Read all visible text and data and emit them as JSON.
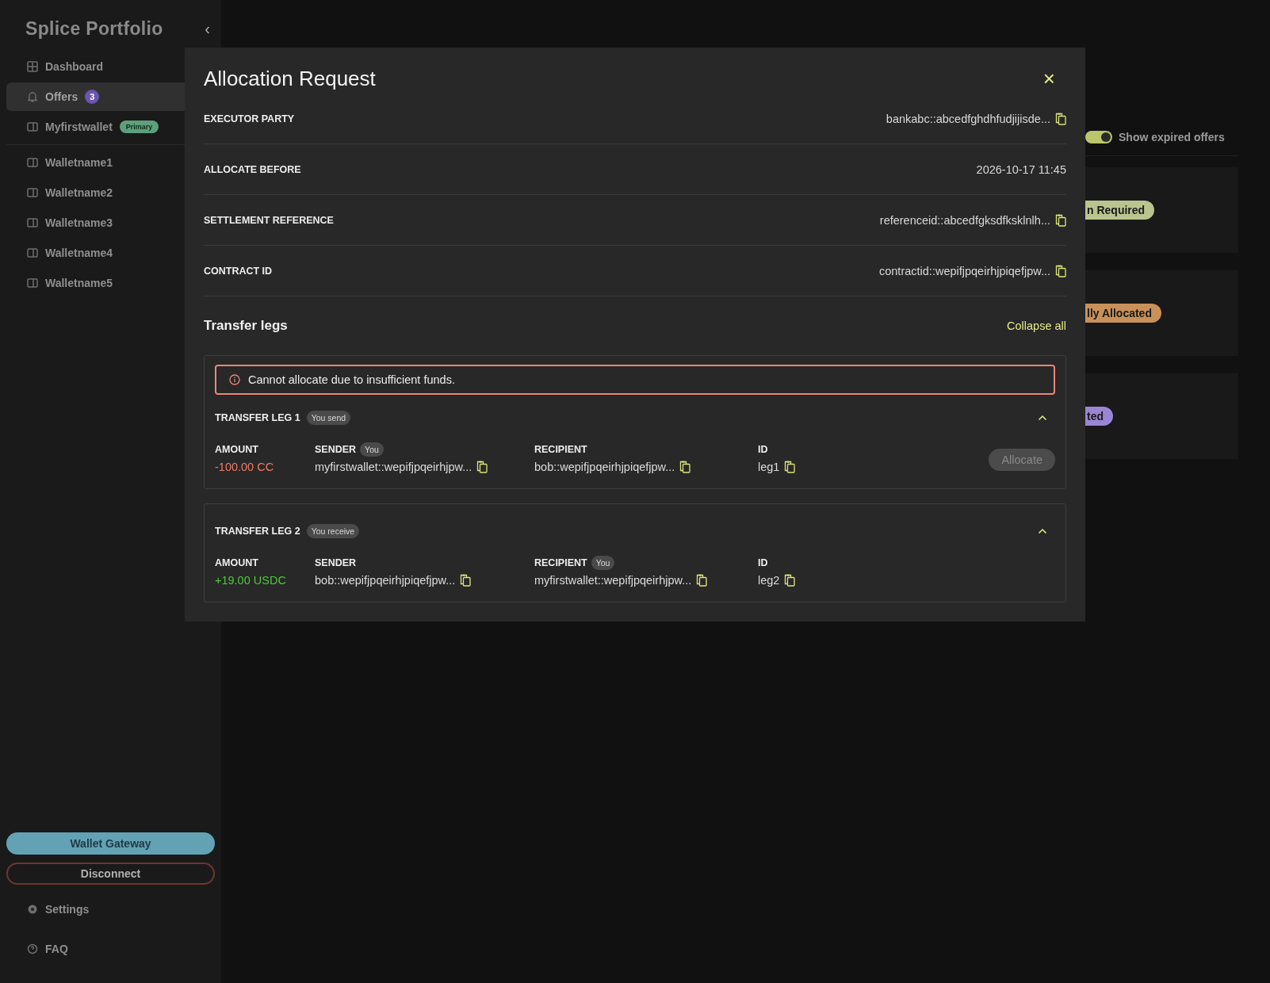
{
  "sidebar": {
    "title": "Splice Portfolio",
    "collapse_glyph": "‹",
    "items": [
      {
        "label": "Dashboard",
        "selected": false
      },
      {
        "label": "Offers",
        "selected": true,
        "badge": "3"
      },
      {
        "label": "Myfirstwallet",
        "selected": false,
        "tag": "Primary"
      },
      {
        "label": "Walletname1",
        "selected": false
      },
      {
        "label": "Walletname2",
        "selected": false
      },
      {
        "label": "Walletname3",
        "selected": false
      },
      {
        "label": "Walletname4",
        "selected": false
      },
      {
        "label": "Walletname5",
        "selected": false
      }
    ],
    "buttons": [
      {
        "label": "Wallet Gateway",
        "kind": "primary"
      },
      {
        "label": "Disconnect",
        "kind": "danger"
      }
    ],
    "footer_items": [
      {
        "label": "Settings"
      },
      {
        "label": "FAQ"
      }
    ]
  },
  "main": {
    "toggle": {
      "label": "Show expired offers",
      "on": true
    },
    "offers": [
      {
        "status": "n Required",
        "color": "#b9c48e"
      },
      {
        "status": "lly Allocated",
        "color": "#c8915a"
      },
      {
        "status": "ted",
        "color": "#9a85d4"
      }
    ]
  },
  "dialog": {
    "title": "Allocation Request",
    "close_glyph": "×",
    "fields": [
      {
        "label": "EXECUTOR PARTY",
        "value": "bankabc::abcedfghdhfudjijisde...",
        "copyable": true
      },
      {
        "label": "ALLOCATE BEFORE",
        "value": "2026-10-17 11:45",
        "copyable": false
      },
      {
        "label": "SETTLEMENT REFERENCE",
        "value": "referenceid::abcedfgksdfksklnlh...",
        "copyable": true
      },
      {
        "label": "CONTRACT ID",
        "value": "contractid::wepifjpqeirhjpiqefjpw...",
        "copyable": true
      }
    ],
    "legs_section": {
      "title": "Transfer legs",
      "action": "Collapse all",
      "alert": {
        "message": "Cannot allocate due to insufficient funds.",
        "kind": "error"
      },
      "legs": [
        {
          "title": "TRANSFER LEG 1",
          "tag": "You send",
          "expanded": true,
          "fields": [
            {
              "kind": "amount",
              "label": "AMOUNT",
              "value": "-100.00 CC",
              "negative": true
            },
            {
              "kind": "party",
              "label": "SENDER",
              "tag": "You",
              "value": "myfirstwallet::wepifjpqeirhjpw...",
              "copyable": true
            },
            {
              "kind": "party",
              "label": "RECIPIENT",
              "value": "bob::wepifjpqeirhjpiqefjpw...",
              "copyable": true
            },
            {
              "kind": "party",
              "label": "ID",
              "value": "leg1",
              "copyable": true
            }
          ],
          "button": {
            "label": "Allocate",
            "disabled": true
          }
        },
        {
          "title": "TRANSFER LEG 2",
          "tag": "You receive",
          "expanded": true,
          "fields": [
            {
              "kind": "amount",
              "label": "AMOUNT",
              "value": "+19.00 USDC",
              "negative": false
            },
            {
              "kind": "party",
              "label": "SENDER",
              "value": "bob::wepifjpqeirhjpiqefjpw...",
              "copyable": true
            },
            {
              "kind": "party",
              "label": "RECIPIENT",
              "tag": "You",
              "value": "myfirstwallet::wepifjpqeirhjpw...",
              "copyable": true
            },
            {
              "kind": "party",
              "label": "ID",
              "value": "leg2",
              "copyable": true
            }
          ]
        }
      ]
    }
  }
}
